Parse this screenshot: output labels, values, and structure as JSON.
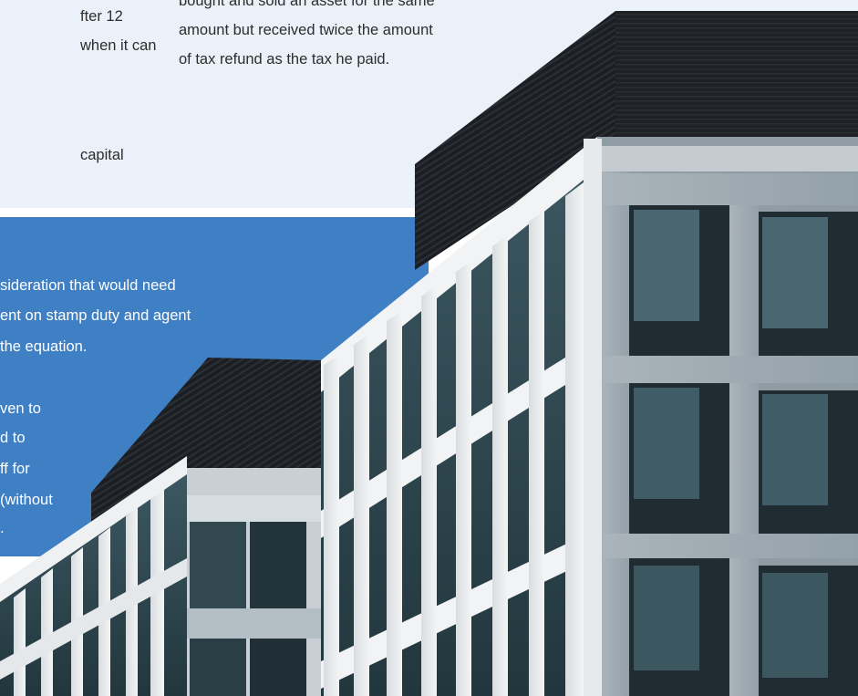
{
  "left_column": {
    "para1_lines": [
      "fter 12",
      "when it can"
    ],
    "para2_lines": [
      "capital"
    ]
  },
  "right_column": {
    "lines": [
      "bought and sold an asset for the same",
      "amount but received twice the amount",
      "of tax refund as the tax he paid."
    ]
  },
  "blue_box": {
    "para1_lines": [
      "sideration that would need",
      "ent on stamp duty and agent",
      "the equation."
    ],
    "para2_lines": [
      "ven to",
      "d to",
      "ff for",
      "(without",
      "."
    ]
  },
  "colors": {
    "light_panel": "#eaf1f8",
    "blue_panel": "#3f7fc3",
    "text": "#2d2d2d"
  }
}
